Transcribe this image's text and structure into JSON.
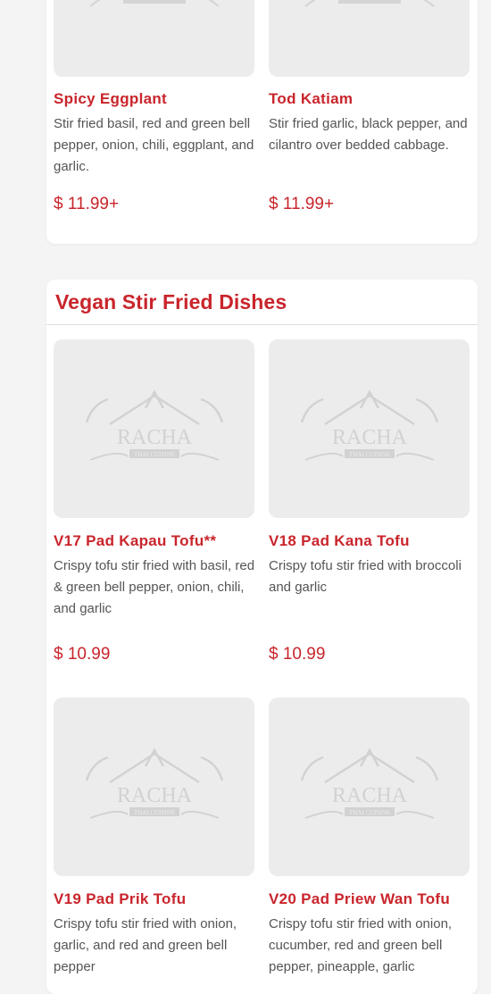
{
  "top_items": [
    {
      "name": "Spicy Eggplant",
      "desc": "Stir fried basil, red and green bell pepper, onion, chili, eggplant, and garlic.",
      "price": "$ 11.99+",
      "logo": "RACHA"
    },
    {
      "name": "Tod Katiam",
      "desc": "Stir fried garlic, black pepper, and cilantro over bedded cabbage.",
      "price": "$ 11.99+",
      "logo": "RACHA"
    }
  ],
  "section": {
    "title": "Vegan Stir Fried Dishes",
    "items": [
      {
        "name": "V17 Pad Kapau Tofu**",
        "desc": "Crispy tofu stir fried with basil, red & green bell pepper, onion, chili, and garlic",
        "price": "$ 10.99",
        "logo": "RACHA",
        "logo_sub": "THAI CUISINE"
      },
      {
        "name": "V18 Pad Kana Tofu",
        "desc": "Crispy tofu stir fried with broccoli and garlic",
        "price": "$ 10.99",
        "logo": "RACHA",
        "logo_sub": "THAI CUISINE"
      },
      {
        "name": "V19 Pad Prik Tofu",
        "desc": "Crispy tofu stir fried with onion, garlic, and red and green bell pepper",
        "logo": "RACHA",
        "logo_sub": "THAI CUISINE"
      },
      {
        "name": "V20 Pad Priew Wan Tofu",
        "desc": "Crispy tofu stir fried with onion, cucumber, red and green bell pepper, pineapple, garlic",
        "logo": "RACHA",
        "logo_sub": "THAI CUISINE"
      }
    ]
  },
  "colors": {
    "accent": "#c9252c",
    "card": "#ffffff",
    "image_placeholder": "#ececec",
    "background": "#f4f4f4"
  },
  "icons": {
    "placeholder": "racha-logo-icon"
  }
}
